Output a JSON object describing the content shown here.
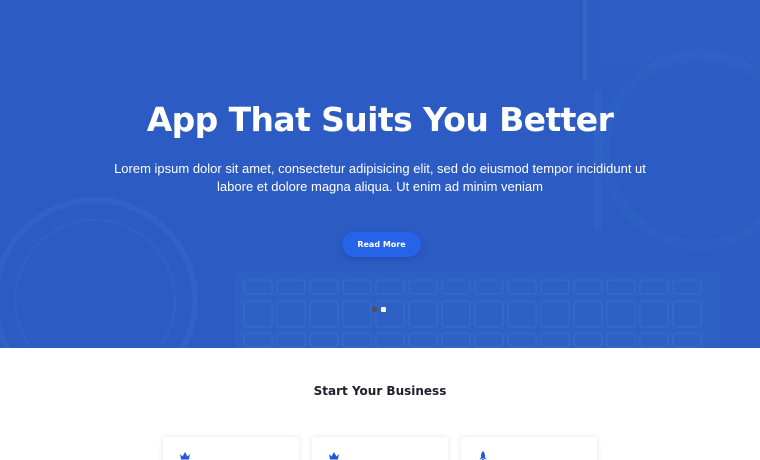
{
  "hero": {
    "title": "App That Suits You Better",
    "subtitle": "Lorem ipsum dolor sit amet, consectetur adipisicing elit, sed do eiusmod tempor incididunt ut labore et dolore magna aliqua. Ut enim ad minim veniam",
    "button_label": "Read More",
    "slides": {
      "count": 2,
      "active_index": 2
    },
    "background_color": "#2c5cc3",
    "button_color": "#2563e8"
  },
  "section": {
    "title": "Start Your Business",
    "cards": [
      {
        "icon": "crown-icon"
      },
      {
        "icon": "crown-icon"
      },
      {
        "icon": "rocket-icon"
      }
    ],
    "icon_color": "#2456d8"
  }
}
